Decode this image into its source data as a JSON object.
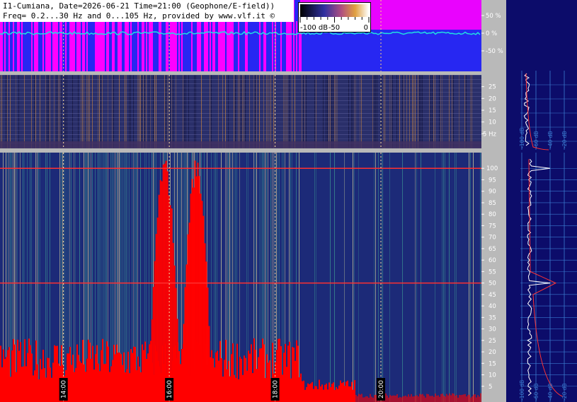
{
  "header": {
    "line1": "I1-Cumiana, Date=2026-06-21 Time=21:00 (Geophone/E-field))",
    "line2": "Freq= 0.2...30 Hz and 0...105 Hz, provided by www.vlf.it ©"
  },
  "colorbar": {
    "ticks": [
      "-100 dB",
      "-50",
      "0"
    ]
  },
  "chart_data": [
    {
      "type": "line",
      "name": "field_strip",
      "y_ticks": [
        "50 %",
        "0 %",
        "-50 %"
      ],
      "ylim": [
        -80,
        80
      ],
      "colors": {
        "background": "#2727f2",
        "saturated": "#ff00ff",
        "trace": "#20e0e0"
      }
    },
    {
      "type": "heatmap",
      "name": "slow_spectrogram",
      "y_ticks": [
        "25",
        "20",
        "15",
        "10",
        "5 Hz"
      ],
      "ylim": [
        0.2,
        30
      ],
      "x_ticks": [
        "14:00",
        "16:00",
        "18:00",
        "20:00"
      ]
    },
    {
      "type": "heatmap",
      "name": "main_spectrogram",
      "y_ticks": [
        "100",
        "95",
        "90",
        "85",
        "80",
        "75",
        "70",
        "65",
        "60",
        "55",
        "50",
        "45",
        "40",
        "35",
        "30",
        "25",
        "20",
        "15",
        "10",
        "5"
      ],
      "ylim": [
        0,
        105
      ],
      "x_ticks": [
        "14:00",
        "16:00",
        "18:00",
        "20:00"
      ],
      "tones_hz": [
        50,
        100
      ],
      "red_bursts": [
        {
          "center_hour": 15.9,
          "peak_hz": 105
        },
        {
          "center_hour": 16.5,
          "peak_hz": 105
        }
      ],
      "colors": {
        "low": "#1c2a78",
        "mid": "#3d9a94",
        "high": "#f0f0a0",
        "sat": "#ff0000"
      }
    },
    {
      "type": "line",
      "name": "side_profile_top",
      "x_ticks": [
        "-100 dB",
        "-60 dB",
        "-40 dB",
        "-20 dB"
      ],
      "colors": {
        "trace": "#ffffff",
        "fit": "#ff3333"
      }
    },
    {
      "type": "line",
      "name": "side_profile_main",
      "x_ticks": [
        "-100 dB",
        "-60 dB",
        "-40 dB",
        "-20 dB"
      ],
      "peaks_hz": [
        50,
        100
      ],
      "colors": {
        "trace": "#ffffff",
        "fit": "#ff3333"
      }
    }
  ]
}
